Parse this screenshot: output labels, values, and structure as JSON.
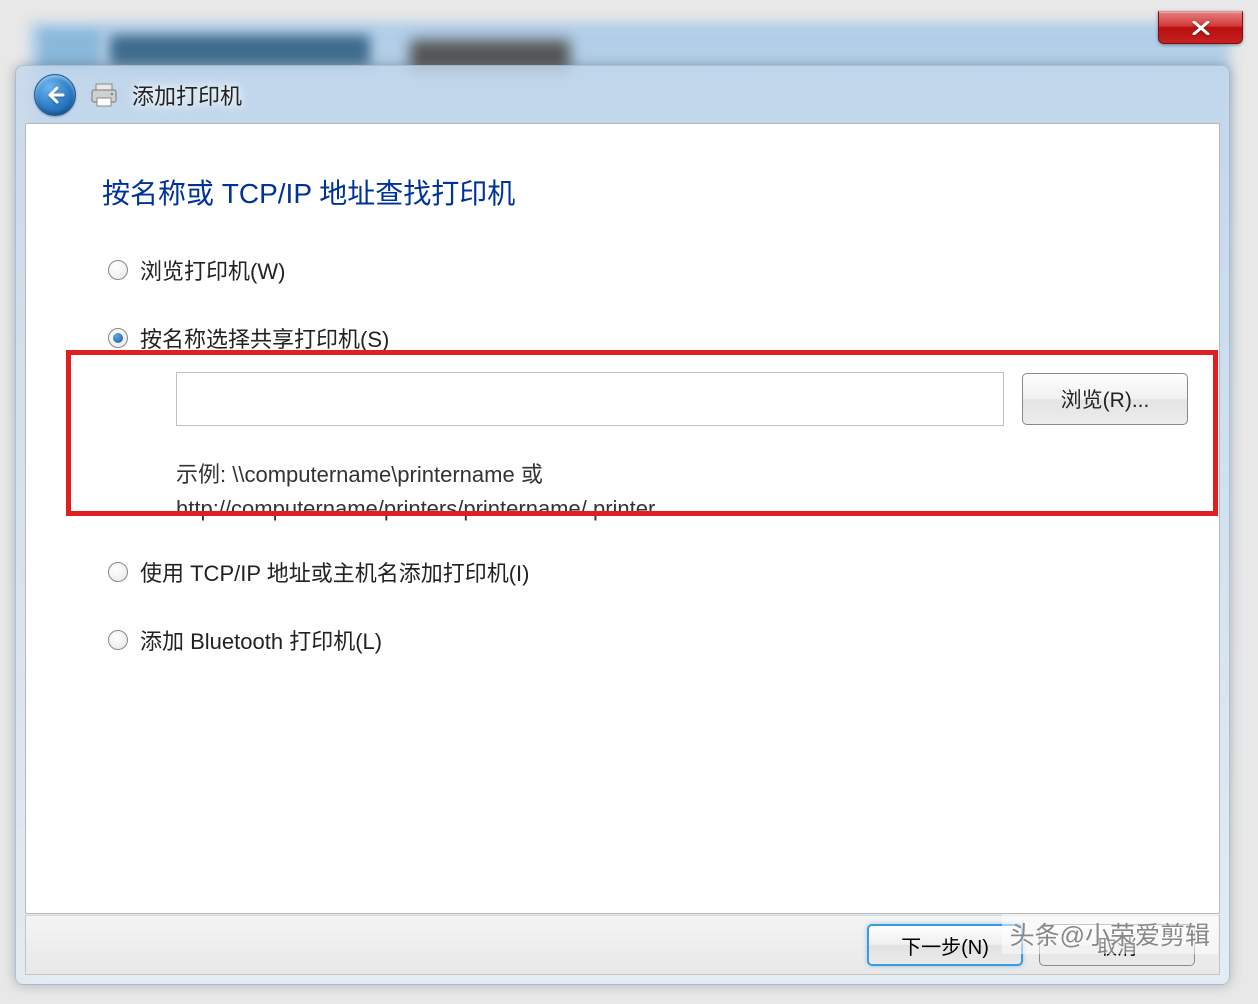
{
  "window": {
    "close_label": "×"
  },
  "wizard": {
    "title": "添加打印机",
    "heading": "按名称或 TCP/IP 地址查找打印机",
    "options": {
      "browse_printers": "浏览打印机(W)",
      "select_by_name": "按名称选择共享打印机(S)",
      "use_tcpip": "使用 TCP/IP 地址或主机名添加打印机(I)",
      "add_bluetooth": "添加 Bluetooth 打印机(L)"
    },
    "name_input_value": "",
    "browse_button": "浏览(R)...",
    "example_prefix": "示例: ",
    "example_line1": "\\\\computername\\printername 或",
    "example_line2": "http://computername/printers/printername/.printer",
    "selected_option": "select_by_name"
  },
  "footer": {
    "next": "下一步(N)",
    "cancel": "取消"
  },
  "watermark": "头条@小荣爱剪辑"
}
